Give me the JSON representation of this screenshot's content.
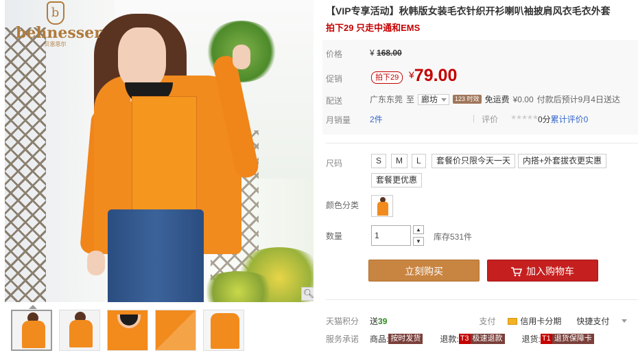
{
  "brand": {
    "name": "behnesser",
    "sub": "贝恩思尔",
    "mark": "b"
  },
  "gallery": {
    "zoom_icon": "magnifier-icon",
    "thumbnails": [
      "thumb-1",
      "thumb-2",
      "thumb-3",
      "thumb-4",
      "thumb-5"
    ]
  },
  "product": {
    "title": "【VIP专享活动】秋韩版女装毛衣针织开衫喇叭袖披肩风衣毛衣外套",
    "subtitle": "拍下29 只走中通和EMS"
  },
  "price": {
    "label": "价格",
    "currency": "¥",
    "original": "168.00",
    "promo_label": "促销",
    "promo_badge": "拍下29",
    "promo_value": "79.00"
  },
  "shipping": {
    "label": "配送",
    "from": "广东东莞",
    "to_word": "至",
    "dest": "廊坊",
    "time_badge": "123 时效",
    "fee_text": "免运费",
    "fee_value": "¥0.00",
    "delivery_note": "付款后预计9月4日送达"
  },
  "sales": {
    "label": "月销量",
    "value": "2件",
    "review_label": "评价",
    "stars": "★★★★★",
    "score_text": "0分",
    "review_count": "累计评价0"
  },
  "size": {
    "label": "尺码",
    "options": [
      "S",
      "M",
      "L",
      "套餐价只限今天一天",
      "内搭+外套拔衣更实惠",
      "套餐更优惠"
    ]
  },
  "color": {
    "label": "颜色分类"
  },
  "quantity": {
    "label": "数量",
    "value": "1",
    "up": "▲",
    "down": "▼",
    "stock": "库存531件"
  },
  "actions": {
    "buy": "立刻购买",
    "cart": "加入购物车"
  },
  "points": {
    "label": "天猫积分",
    "prefix": "送",
    "value": "39"
  },
  "payment": {
    "label": "支付",
    "credit": "信用卡分期",
    "quick": "快捷支付"
  },
  "services": {
    "label": "服务承诺",
    "goods_label": "商品:",
    "goods_badge": "按时发货",
    "refund_label": "退款:",
    "refund_t": "T3",
    "refund_badge": "极速退款",
    "return_label": "退货:",
    "return_t": "T1",
    "return_badge": "退货保障卡"
  },
  "colors": {
    "accent_red": "#c40000",
    "buy_button": "#c88441",
    "cart_button": "#c51f1f",
    "coat_orange": "#f18b1e"
  }
}
